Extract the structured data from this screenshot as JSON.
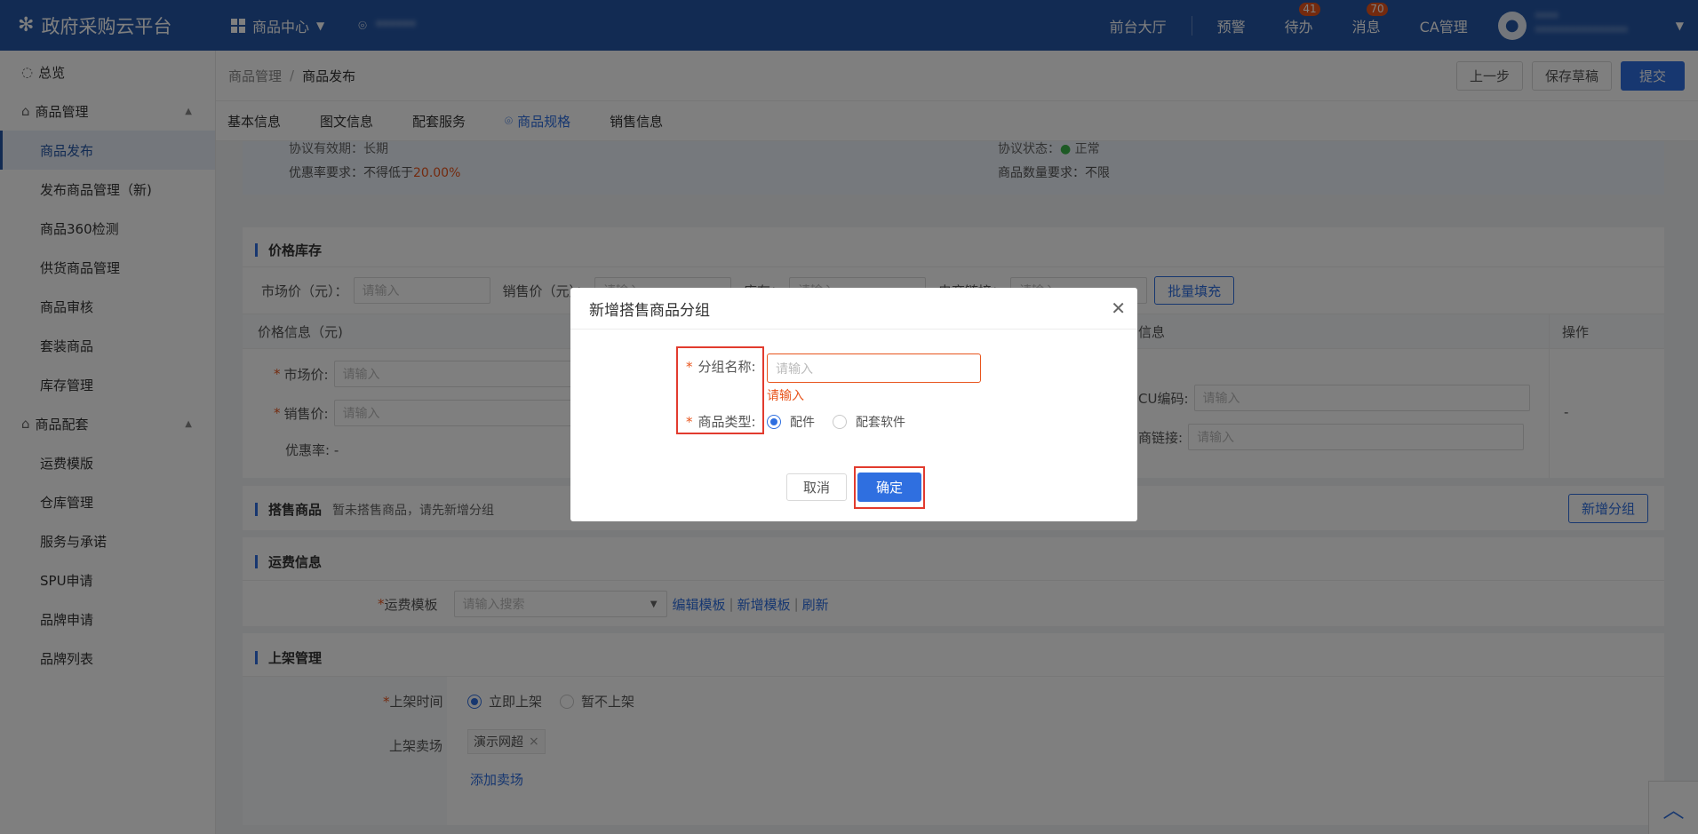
{
  "header": {
    "logo_text": "政府采购云平台",
    "module": "商品中心",
    "location_text": "******",
    "nav": [
      "前台大厅",
      "预警",
      "待办",
      "消息",
      "CA管理"
    ],
    "badges": {
      "todo": "41",
      "message": "70"
    },
    "user_name": "****",
    "user_sub": "****************"
  },
  "sidebar": {
    "overview": "总览",
    "group1": "商品管理",
    "group1_items": [
      "商品发布",
      "发布商品管理（新)",
      "商品360检测",
      "供货商品管理",
      "商品审核",
      "套装商品",
      "库存管理"
    ],
    "group2": "商品配套",
    "group2_items": [
      "运费模版",
      "仓库管理",
      "服务与承诺",
      "SPU申请",
      "品牌申请",
      "品牌列表"
    ]
  },
  "breadcrumb": {
    "parent": "商品管理",
    "current": "商品发布"
  },
  "toolbar": {
    "prev": "上一步",
    "save_draft": "保存草稿",
    "submit": "提交"
  },
  "tabs": [
    "基本信息",
    "图文信息",
    "配套服务",
    "商品规格",
    "销售信息"
  ],
  "info": {
    "validity_label": "协议有效期：",
    "validity_value": "长期",
    "status_label": "协议状态：",
    "status_value": "正常",
    "discount_label": "优惠率要求：",
    "discount_prefix": "不得低于",
    "discount_value": "20.00%",
    "qty_label": "商品数量要求：",
    "qty_value": "不限"
  },
  "price_stock": {
    "title": "价格库存",
    "market_price_label": "市场价（元）：",
    "sale_price_label": "销售价（元）：",
    "stock_label": "库存：",
    "ecom_link_label": "电商链接：",
    "placeholder": "请输入",
    "batch_fill": "批量填充",
    "col_price_info": "价格信息（元)",
    "col_other_info": "信息",
    "col_action": "操作",
    "row_market_label": "市场价:",
    "row_sale_label": "销售价:",
    "row_discount_label": "优惠率:",
    "row_discount_value": "-",
    "sku_label": "CU编码:",
    "link_label": "商链接:",
    "action_value": "-"
  },
  "bundle": {
    "title": "搭售商品",
    "hint": "暂未搭售商品，请先新增分组",
    "add_group": "新增分组"
  },
  "shipping": {
    "title": "运费信息",
    "template_label": "运费模板",
    "template_placeholder": "请输入搜索",
    "edit": "编辑模板",
    "add": "新增模板",
    "refresh": "刷新"
  },
  "listing": {
    "title": "上架管理",
    "time_label": "上架时间",
    "time_opt1": "立即上架",
    "time_opt2": "暂不上架",
    "market_label": "上架卖场",
    "market_tag": "演示网超",
    "add_market": "添加卖场"
  },
  "modal": {
    "title": "新增搭售商品分组",
    "name_label": "分组名称:",
    "name_placeholder": "请输入",
    "name_error": "请输入",
    "type_label": "商品类型:",
    "type_opt1": "配件",
    "type_opt2": "配套软件",
    "cancel": "取消",
    "confirm": "确定"
  },
  "colors": {
    "primary": "#2557a7",
    "accent": "#2f6fe0",
    "error": "#e8551d",
    "highlight": "#e23b2e"
  }
}
